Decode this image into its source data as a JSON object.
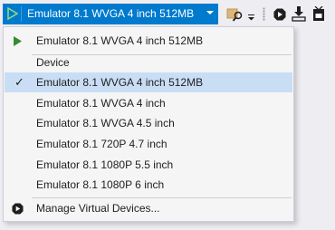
{
  "toolbar": {
    "run_label": "Emulator 8.1 WVGA 4 inch 512MB",
    "icons": [
      "play-icon",
      "dropdown-chevron-icon",
      "find-in-files-icon",
      "overflow-menu-icon",
      "record-icon",
      "step-icon",
      "device-icon"
    ]
  },
  "menu": {
    "recent": "Emulator 8.1 WVGA 4 inch 512MB",
    "group_header": "Device",
    "devices": [
      {
        "label": "Emulator 8.1 WVGA 4 inch 512MB",
        "checked": true
      },
      {
        "label": "Emulator 8.1 WVGA 4 inch",
        "checked": false
      },
      {
        "label": "Emulator 8.1 WVGA 4.5 inch",
        "checked": false
      },
      {
        "label": "Emulator 8.1 720P 4.7 inch",
        "checked": false
      },
      {
        "label": "Emulator 8.1 1080P 5.5 inch",
        "checked": false
      },
      {
        "label": "Emulator 8.1 1080P 6 inch",
        "checked": false
      }
    ],
    "manage": "Manage Virtual Devices..."
  },
  "colors": {
    "accent": "#007acc",
    "selected_bg": "#c9def5",
    "play_green": "#388a34"
  }
}
